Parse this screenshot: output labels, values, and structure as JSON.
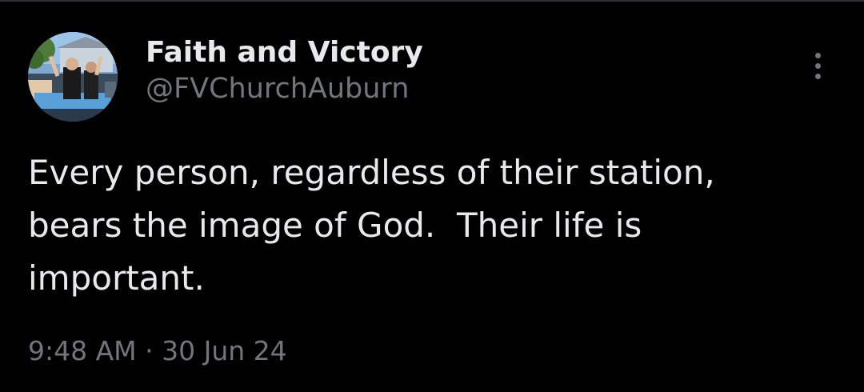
{
  "colors": {
    "background": "#000000",
    "primary_text": "#e7e9ea",
    "secondary_text": "#71767b"
  },
  "tweet": {
    "author": {
      "display_name": "Faith and Victory",
      "handle": "@FVChurchAuburn",
      "avatar_icon": "profile-photo-avatar"
    },
    "more_icon": "more-options-vertical-dots-icon",
    "text_lines": [
      "Every person, regardless of their station,",
      "bears the image of God.  Their life is",
      "important."
    ],
    "time": "9:48 AM",
    "separator": " · ",
    "date": "30 Jun 24"
  }
}
